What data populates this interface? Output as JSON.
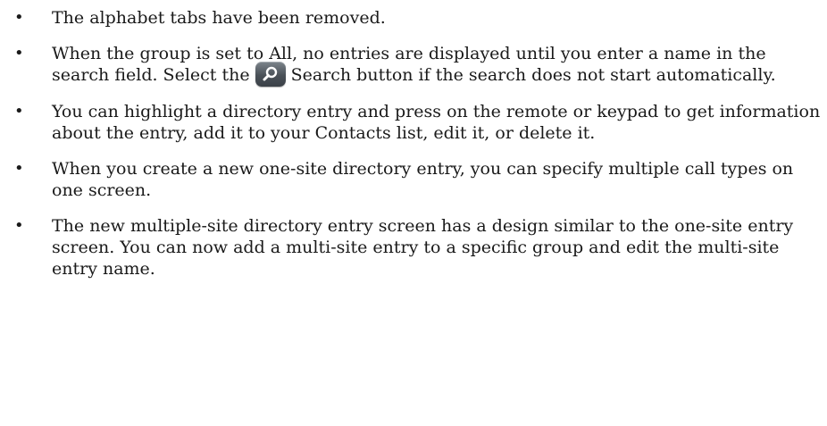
{
  "bullets": [
    {
      "text": "The alphabet tabs have been removed."
    },
    {
      "text_before": "When the group is set to All, no entries are displayed until you enter a name in the search field. Select the",
      "icon": "search-icon",
      "text_after": "Search button if the search does not start automatically."
    },
    {
      "text": "You can highlight a directory entry and press on the remote or keypad to get information about the entry, add it to your Contacts list, edit it, or delete it."
    },
    {
      "text": "When you create a new one-site directory entry, you can specify multiple call types on one screen."
    },
    {
      "text": "The new multiple-site directory entry screen has a design similar to the one-site entry screen. You can now add a multi-site entry to a specific group and edit the multi-site entry name."
    }
  ],
  "bullet_glyph": "•",
  "colors": {
    "text": "#1a1a1a",
    "search_button": "#4a5158"
  }
}
